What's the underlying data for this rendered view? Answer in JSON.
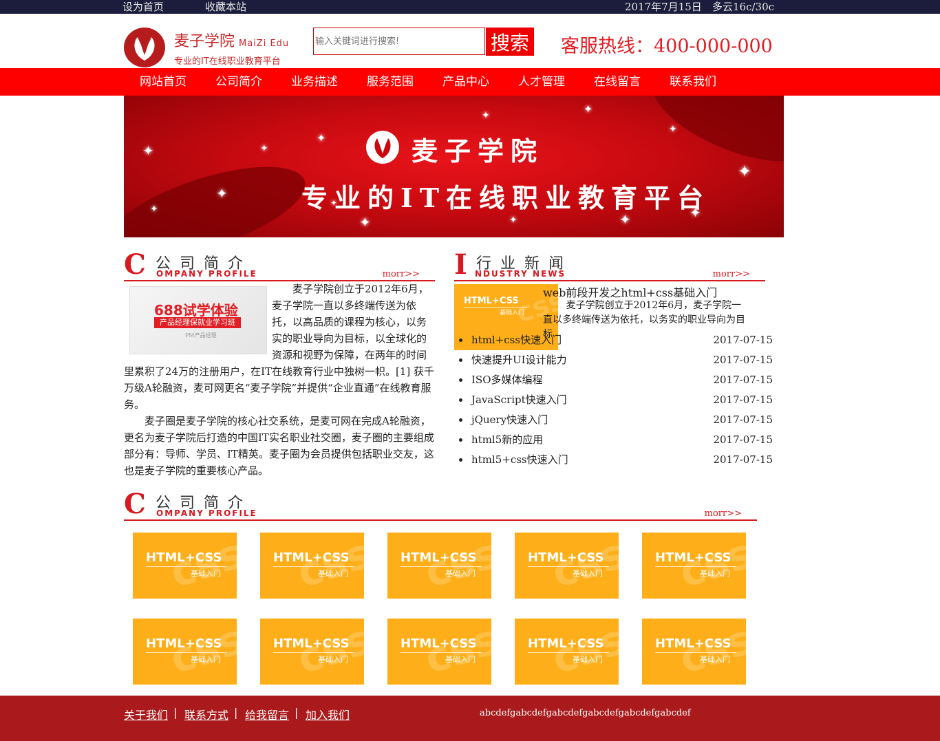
{
  "topbar": {
    "set_home": "设为首页",
    "favorite": "收藏本站",
    "date": "2017年7月15日",
    "weather": "多云16c/30c"
  },
  "header": {
    "logo_name": "麦子学院",
    "logo_en": "MaiZi Edu",
    "logo_tagline": "专业的IT在线职业教育平台",
    "search_placeholder": "输入关键词进行搜索!",
    "search_button": "搜索",
    "hotline": "客服热线：400-000-000"
  },
  "nav": {
    "items": [
      {
        "label": "网站首页"
      },
      {
        "label": "公司简介"
      },
      {
        "label": "业务描述"
      },
      {
        "label": "服务范围"
      },
      {
        "label": "产品中心"
      },
      {
        "label": "人才管理"
      },
      {
        "label": "在线留言"
      },
      {
        "label": "联系我们"
      }
    ]
  },
  "banner": {
    "title": "麦子学院",
    "subtitle": "专业的IT在线职业教育平台"
  },
  "profile": {
    "letter": "C",
    "heading": "公司简介",
    "heading_en": "OMPANY PROFILE",
    "more": "morr>>",
    "promo": {
      "line1": "688试学体验",
      "line2": "产品经理保就业学习班",
      "line3": "PM产品经理"
    },
    "paragraph1": "麦子学院创立于2012年6月，麦子学院一直以多终端传送为依托，以高品质的课程为核心，以务实的职业导向为目标，以全球化的资源和视野为保障，在两年的时间里累积了24万的注册用户，在IT在线教育行业中独树一帜。[1] 获千万级A轮融资，麦可网更名“麦子学院”并提供“企业直通”在线教育服务。",
    "paragraph2": "麦子圈是麦子学院的核心社交系统，是麦可网在完成A轮融资，更名为麦子学院后打造的中国IT实名职业社交圈，麦子圈的主要组成部分有：导师、学员、IT精英。麦子圈为会员提供包括职业交友，这也是麦子学院的重要核心产品。"
  },
  "news": {
    "letter": "I",
    "heading": "行业新闻",
    "heading_en": "NDUSTRY NEWS",
    "more": "morr>>",
    "thumb": {
      "line1": "HTML+CSS",
      "line2": "基础入门"
    },
    "featured_title": "web前段开发之html+css基础入门",
    "featured_desc": "麦子学院创立于2012年6月，麦子学院一直以多终端传送为依托，以务实的职业导向为目标",
    "items": [
      {
        "title": "html+css快速入门",
        "date": "2017-07-15"
      },
      {
        "title": "快速提升UI设计能力",
        "date": "2017-07-15"
      },
      {
        "title": "ISO多媒体编程",
        "date": "2017-07-15"
      },
      {
        "title": "JavaScript快速入门",
        "date": "2017-07-15"
      },
      {
        "title": "jQuery快速入门",
        "date": "2017-07-15"
      },
      {
        "title": "html5新的应用",
        "date": "2017-07-15"
      },
      {
        "title": "html5+css快速入门",
        "date": "2017-07-15"
      }
    ]
  },
  "courses": {
    "letter": "C",
    "heading": "公司简介",
    "heading_en": "OMPANY PROFILE",
    "more": "morr>>",
    "items": [
      {
        "line1": "HTML+CSS",
        "line2": "基础入门"
      },
      {
        "line1": "HTML+CSS",
        "line2": "基础入门"
      },
      {
        "line1": "HTML+CSS",
        "line2": "基础入门"
      },
      {
        "line1": "HTML+CSS",
        "line2": "基础入门"
      },
      {
        "line1": "HTML+CSS",
        "line2": "基础入门"
      },
      {
        "line1": "HTML+CSS",
        "line2": "基础入门"
      },
      {
        "line1": "HTML+CSS",
        "line2": "基础入门"
      },
      {
        "line1": "HTML+CSS",
        "line2": "基础入门"
      },
      {
        "line1": "HTML+CSS",
        "line2": "基础入门"
      },
      {
        "line1": "HTML+CSS",
        "line2": "基础入门"
      }
    ]
  },
  "footer": {
    "links": [
      {
        "label": "关于我们"
      },
      {
        "label": "联系方式"
      },
      {
        "label": "给我留言"
      },
      {
        "label": "加入我们"
      }
    ],
    "separator": "|",
    "text": "abcdefgabcdefgabcdefgabcdefgabcdefgabcdef"
  },
  "colors": {
    "topbar": "#1c1d3c",
    "nav": "#ff0000",
    "accent": "#d71920",
    "course_tile": "#fdae18",
    "footer": "#aa1a1c"
  }
}
